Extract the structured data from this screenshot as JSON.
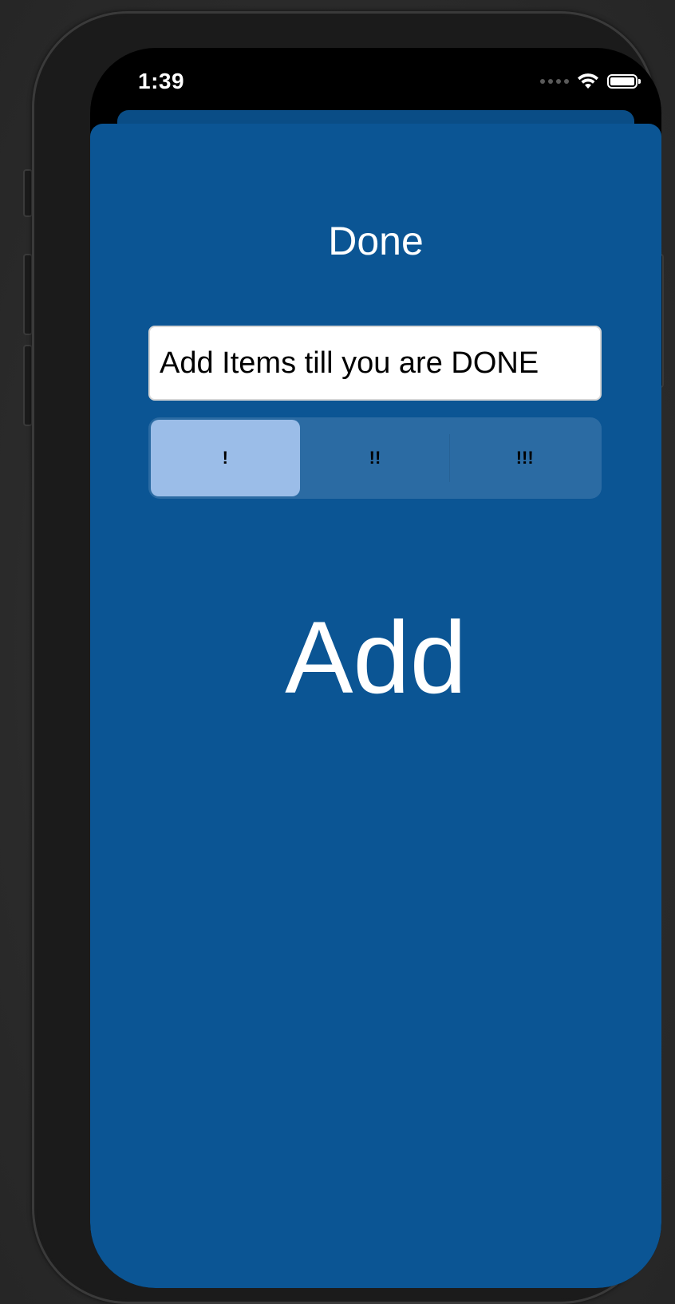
{
  "status_bar": {
    "time": "1:39",
    "wifi_icon": "wifi-icon",
    "battery_icon": "battery-icon"
  },
  "sheet": {
    "title": "Done",
    "item_field": {
      "value": "Add Items till you are DONE",
      "placeholder": ""
    },
    "priority_segments": [
      {
        "label": "!",
        "selected": true
      },
      {
        "label": "!!",
        "selected": false
      },
      {
        "label": "!!!",
        "selected": false
      }
    ],
    "add_label": "Add"
  },
  "colors": {
    "sheet_background": "#0b5594",
    "segment_selected": "#9bbde8",
    "segment_background": "#2b6ba3",
    "text_primary": "#ffffff"
  }
}
